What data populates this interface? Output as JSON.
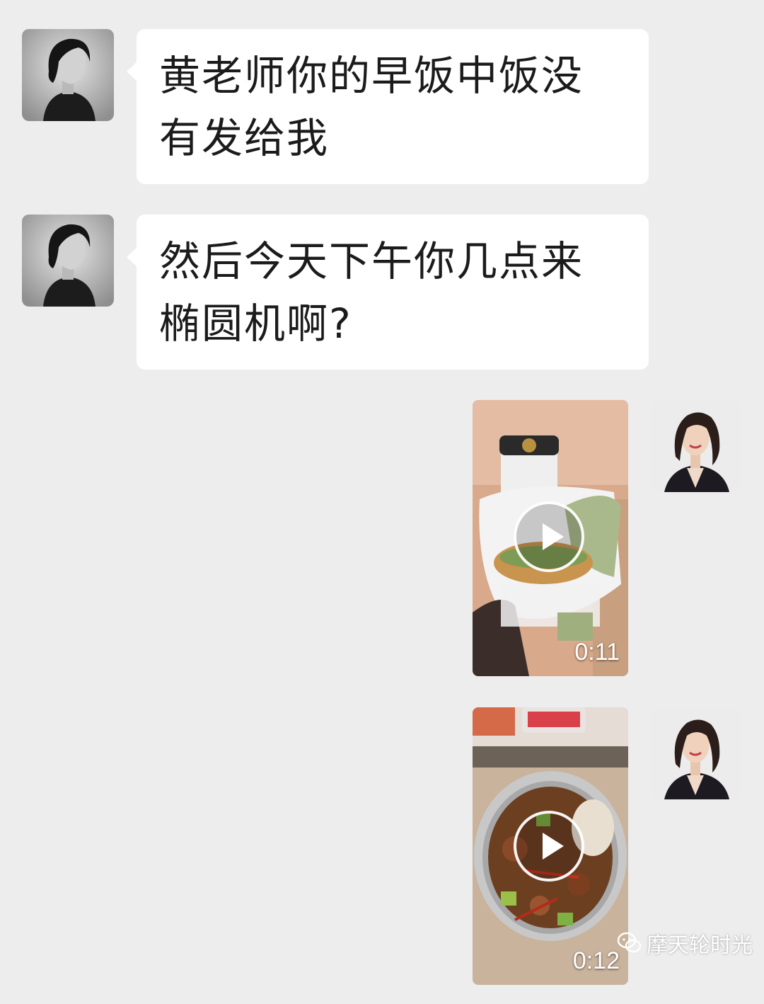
{
  "messages": [
    {
      "sender": "contact",
      "avatar_icon": "person-avatar-bw",
      "lines": [
        "黄老师你的早饭中饭没",
        "有发给我"
      ]
    },
    {
      "sender": "contact",
      "avatar_icon": "person-avatar-bw",
      "lines": [
        "然后今天下午你几点来",
        "椭圆机啊?"
      ]
    },
    {
      "sender": "self",
      "avatar_icon": "person-avatar-color",
      "type": "video",
      "duration": "0:11",
      "play_icon": "play-icon"
    },
    {
      "sender": "self",
      "avatar_icon": "person-avatar-color",
      "type": "video",
      "duration": "0:12",
      "play_icon": "play-icon"
    }
  ],
  "watermark": {
    "icon": "wechat-icon",
    "text": "摩天轮时光"
  },
  "colors": {
    "background": "#ededed",
    "bubble": "#ffffff",
    "text": "#1b1b1b"
  }
}
